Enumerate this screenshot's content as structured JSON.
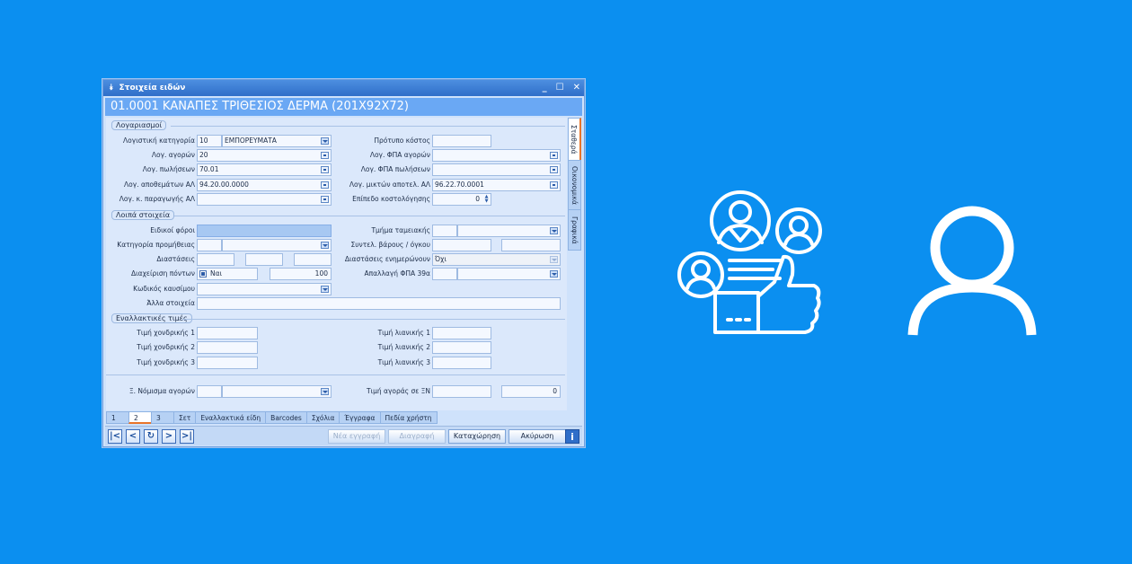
{
  "window": {
    "title": "Στοιχεία ειδών",
    "header": "01.0001 ΚΑΝΑΠΕΣ ΤΡΙΘΕΣΙΟΣ ΔΕΡΜΑ (201Χ92Χ72)"
  },
  "vtabs": [
    "Σταθερά",
    "Οικονομικά",
    "Γραφικά"
  ],
  "groups": {
    "accounts": "Λογαριασμοί",
    "other": "Λοιπά στοιχεία",
    "alt_prices": "Εναλλακτικές τιμές"
  },
  "left_fields": {
    "logistiki_label": "Λογιστική κατηγορία",
    "logistiki_code": "10",
    "logistiki_name": "ΕΜΠΟΡΕΥΜΑΤΑ",
    "agoron_label": "Λογ. αγορών",
    "agoron_value": "20",
    "poliseon_label": "Λογ. πωλήσεων",
    "poliseon_value": "70.01",
    "apothematon_label": "Λογ. αποθεμάτων ΑΛ",
    "apothematon_value": "94.20.00.0000",
    "paragogis_label": "Λογ. κ. παραγωγής ΑΛ"
  },
  "right_fields": {
    "protypo_label": "Πρότυπο κόστος",
    "fpa_agoron_label": "Λογ. ΦΠΑ αγορών",
    "fpa_poliseon_label": "Λογ. ΦΠΑ πωλήσεων",
    "mikton_label": "Λογ. μικτών αποτελ. ΑΛ",
    "mikton_value": "96.22.70.0001",
    "epipedo_label": "Επίπεδο κοστολόγησης",
    "epipedo_value": "0"
  },
  "other": {
    "eidikoi_label": "Ειδικοί φόροι",
    "promitheias_label": "Κατηγορία προμήθειας",
    "diastaseis_label": "Διαστάσεις",
    "pontoi_label": "Διαχείριση πόντων",
    "pontoi_check": "Ναι",
    "pontoi_value": "100",
    "kausimou_label": "Κωδικός καυσίμου",
    "alla_label": "Άλλα στοιχεία",
    "tmima_label": "Τμήμα ταμειακής",
    "syntel_label": "Συντελ. βάρους / όγκου",
    "enimer_label": "Διαστάσεις ενημερώνουν",
    "enimer_value": "Όχι",
    "apallagi_label": "Απαλλαγή ΦΠΑ 39α"
  },
  "prices": {
    "xondr1": "Τιμή χονδρικής 1",
    "xondr2": "Τιμή χονδρικής 2",
    "xondr3": "Τιμή χονδρικής 3",
    "lian1": "Τιμή λιανικής 1",
    "lian2": "Τιμή λιανικής 2",
    "lian3": "Τιμή λιανικής 3",
    "nomisma_label": "Ξ. Νόμισμα αγορών",
    "timi_xn_label": "Τιμή αγοράς σε ΞΝ",
    "timi_xn_value": "0"
  },
  "htabs": [
    "1",
    "2",
    "3",
    "Σετ",
    "Εναλλακτικά είδη",
    "Barcodes",
    "Σχόλια",
    "Έγγραφα",
    "Πεδία χρήστη"
  ],
  "buttons": {
    "new": "Νέα εγγραφή",
    "delete": "Διαγραφή",
    "save": "Καταχώρηση",
    "cancel": "Ακύρωση",
    "info": "i"
  },
  "nav": [
    "|<",
    "<",
    "↻",
    ">",
    ">|"
  ]
}
